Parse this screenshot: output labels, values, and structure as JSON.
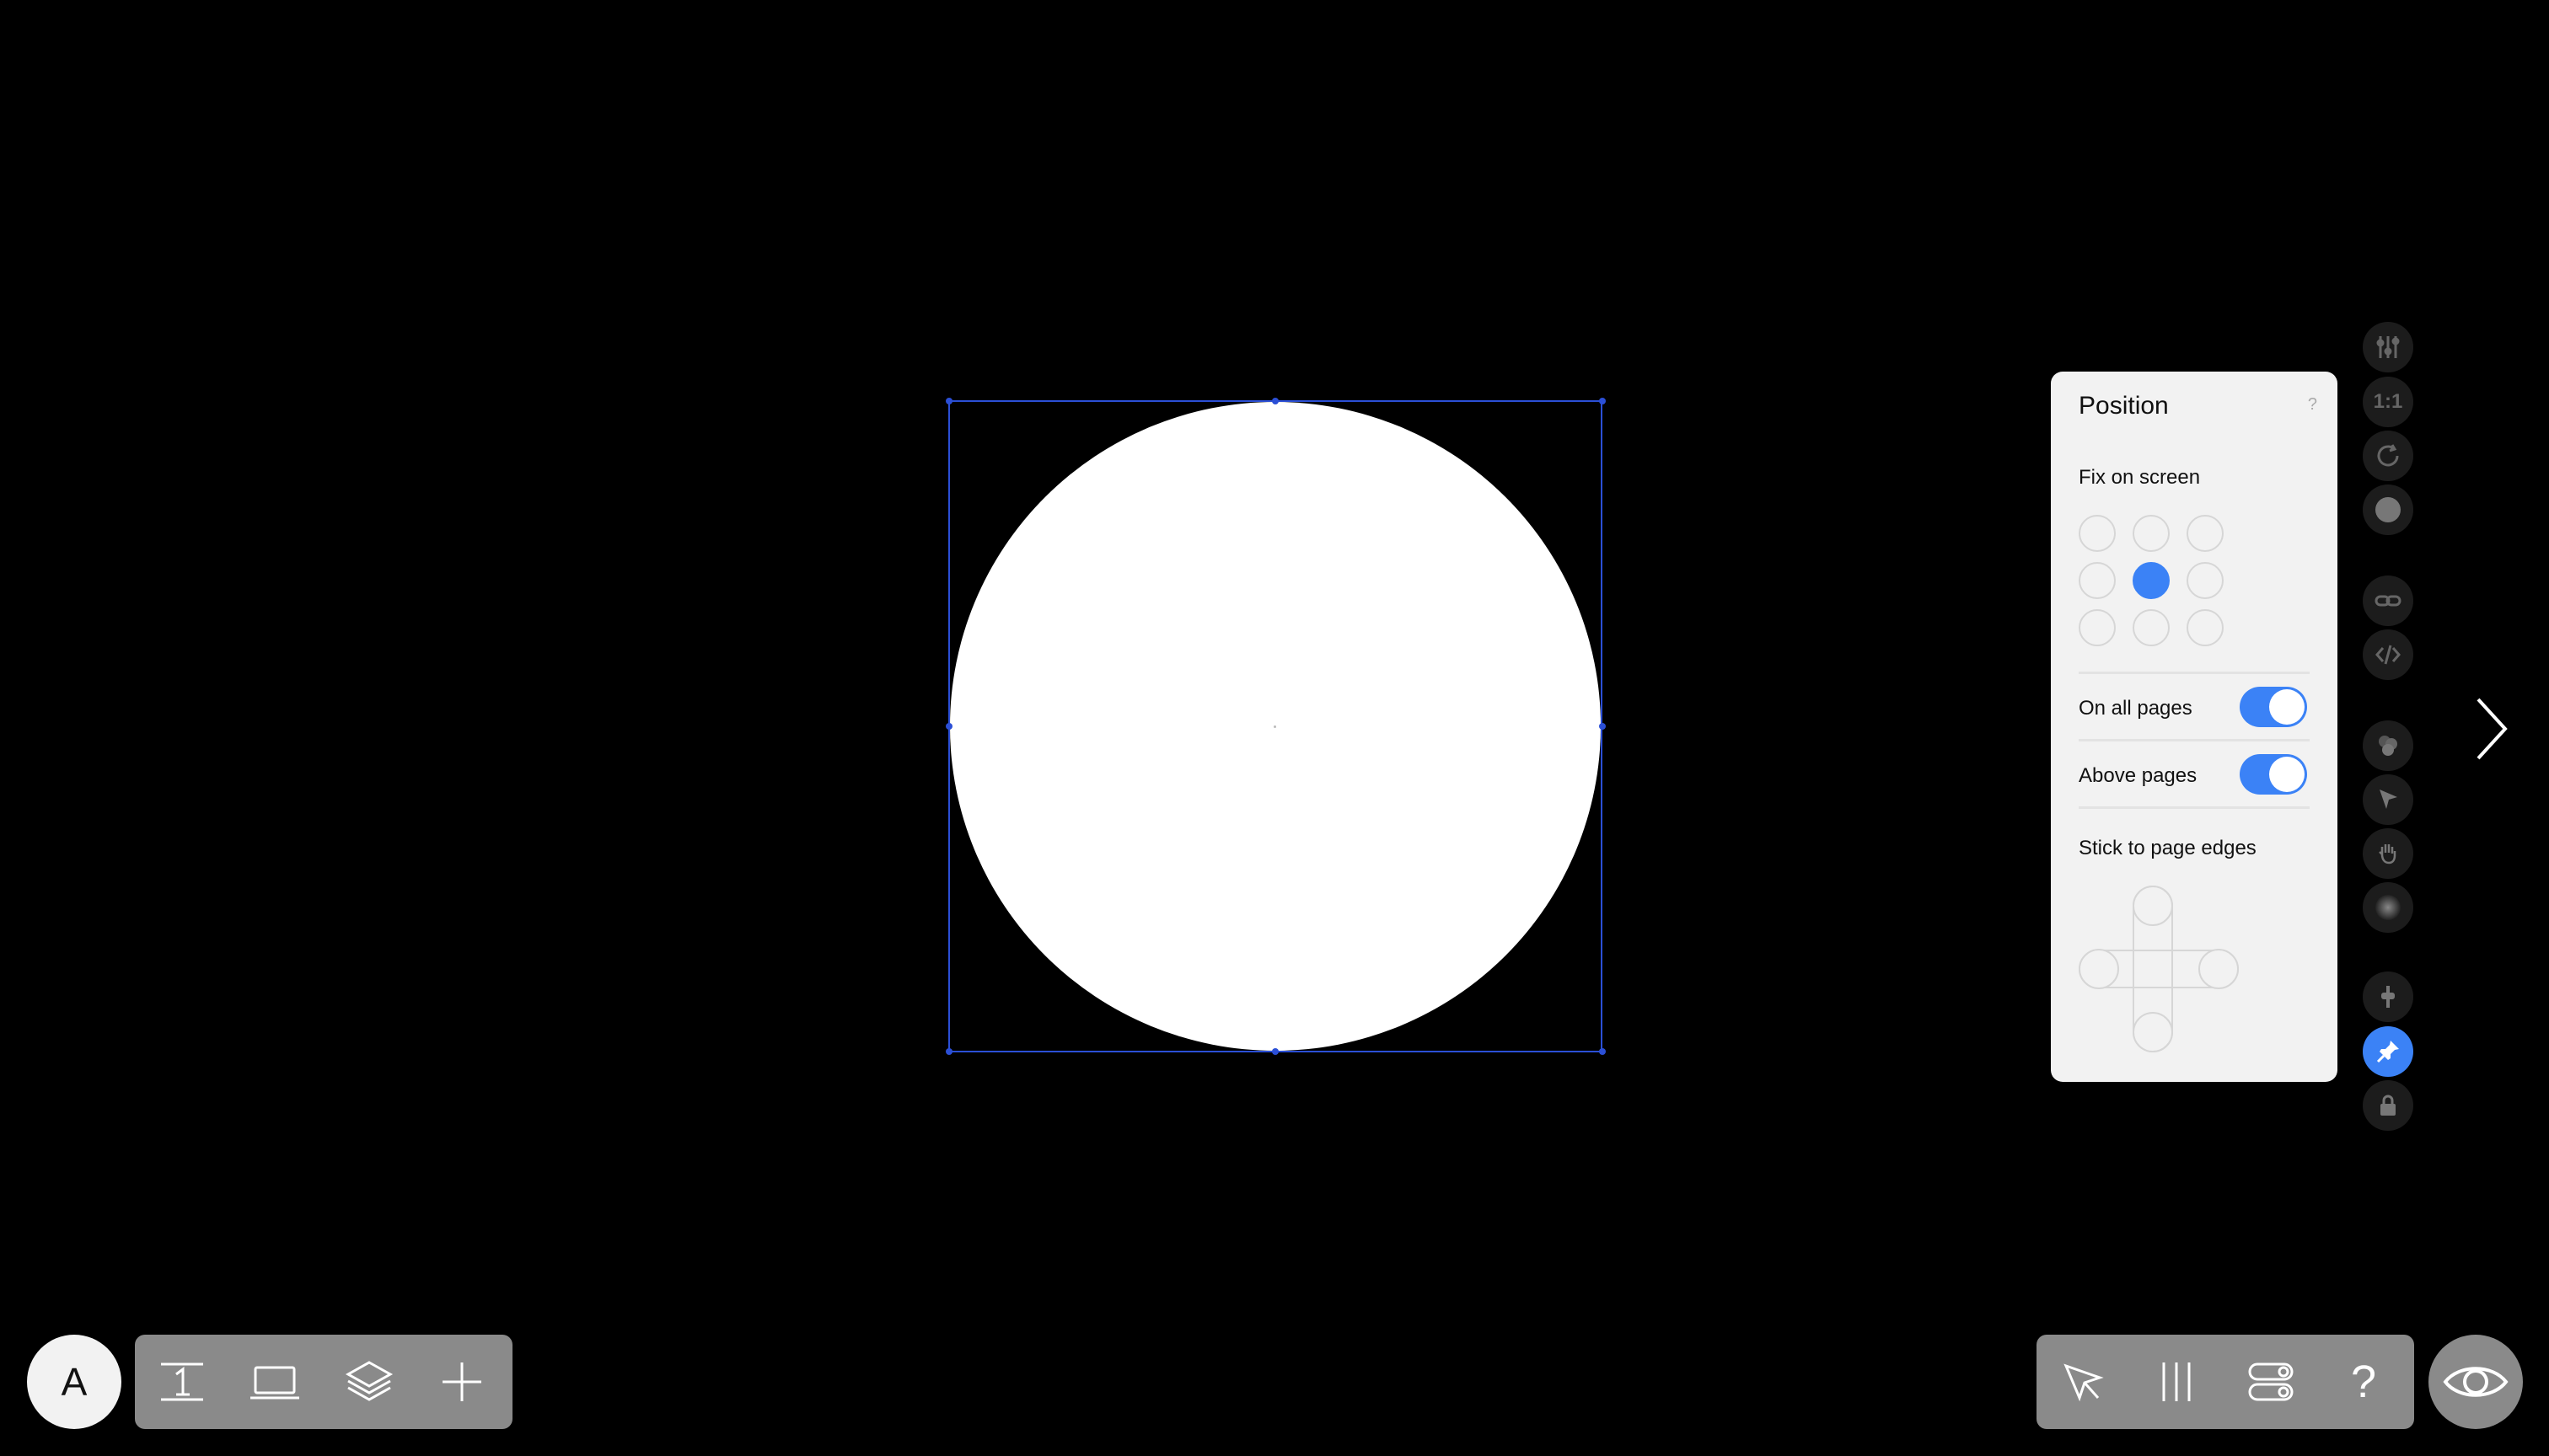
{
  "panel": {
    "title": "Position",
    "help": "?",
    "fix_on_screen": "Fix on screen",
    "on_all_pages": "On all pages",
    "above_pages": "Above pages",
    "stick_to_edges": "Stick to page edges",
    "toggles": {
      "on_all_pages": true,
      "above_pages": true
    },
    "fix_grid_selected": "center"
  },
  "right_toolbar": {
    "aspect_label": "1:1",
    "items": [
      "sliders-icon",
      "aspect-ratio-icon",
      "rotate-icon",
      "fill-color-icon",
      "link-icon",
      "code-icon",
      "effects-icon",
      "cursor-interaction-icon",
      "hand-icon",
      "shadow-icon",
      "anchor-icon",
      "pin-icon",
      "lock-icon"
    ],
    "active": "pin-icon"
  },
  "bottom_left": {
    "avatar_letter": "A",
    "items": [
      "page-number-icon",
      "device-icon",
      "layers-icon",
      "add-icon"
    ]
  },
  "bottom_right": {
    "items": [
      "select-tool-icon",
      "columns-icon",
      "settings-toggle-icon",
      "help-icon"
    ],
    "help_label": "?"
  },
  "preview": "eye-icon",
  "colors": {
    "accent": "#3b82f6",
    "selection": "#2b4fd6",
    "panel_bg": "#f2f2f2",
    "toolbar_bg": "#8a8a8a"
  }
}
